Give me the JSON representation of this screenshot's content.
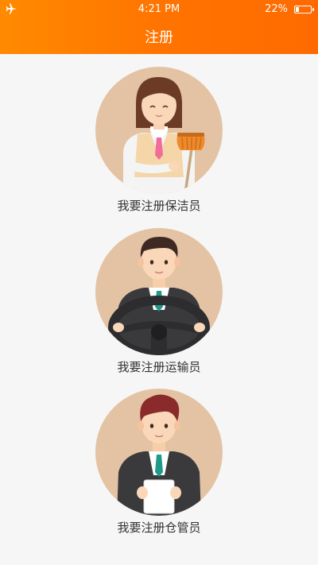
{
  "status_bar": {
    "time": "4:21 PM",
    "battery_percent": "22%",
    "battery_level": 0.22
  },
  "header": {
    "title": "注册"
  },
  "options": [
    {
      "label": "我要注册保洁员",
      "icon": "cleaner-avatar-icon"
    },
    {
      "label": "我要注册运输员",
      "icon": "driver-avatar-icon"
    },
    {
      "label": "我要注册仓管员",
      "icon": "warehouse-keeper-avatar-icon"
    }
  ],
  "colors": {
    "header_accent": "#ff7a00",
    "avatar_circle": "#e3c3a4"
  }
}
